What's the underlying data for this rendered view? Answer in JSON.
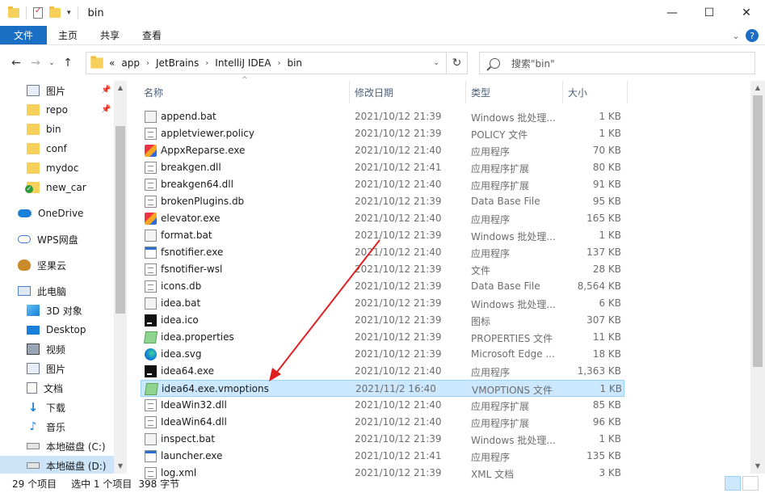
{
  "window": {
    "title": "bin",
    "min_glyph": "—",
    "max_glyph": "☐",
    "close_glyph": "✕"
  },
  "ribbon": {
    "tabs": [
      "文件",
      "主页",
      "共享",
      "查看"
    ],
    "help_glyph": "?"
  },
  "address": {
    "overflow": "«",
    "crumbs": [
      "app",
      "JetBrains",
      "IntelliJ IDEA",
      "bin"
    ],
    "search_placeholder": "搜索\"bin\""
  },
  "nav": {
    "quick_access": [
      {
        "label": "图片",
        "icon": "pictures-icon",
        "pinned": true
      },
      {
        "label": "repo",
        "icon": "folder-icon",
        "pinned": true
      },
      {
        "label": "bin",
        "icon": "folder-icon",
        "pinned": false
      },
      {
        "label": "conf",
        "icon": "folder-icon",
        "pinned": false
      },
      {
        "label": "mydoc",
        "icon": "folder-icon",
        "pinned": false
      },
      {
        "label": "new_car",
        "icon": "folder-check-icon",
        "pinned": false
      }
    ],
    "onedrive": "OneDrive",
    "wps": "WPS网盘",
    "jianguoyun": "坚果云",
    "this_pc": "此电脑",
    "pc_items": [
      {
        "label": "3D 对象",
        "icon": "3d-objects-icon"
      },
      {
        "label": "Desktop",
        "icon": "desktop-icon"
      },
      {
        "label": "视频",
        "icon": "videos-icon"
      },
      {
        "label": "图片",
        "icon": "pictures-icon"
      },
      {
        "label": "文档",
        "icon": "documents-icon"
      },
      {
        "label": "下载",
        "icon": "downloads-icon"
      },
      {
        "label": "音乐",
        "icon": "music-icon"
      },
      {
        "label": "本地磁盘 (C:)",
        "icon": "drive-c-icon"
      },
      {
        "label": "本地磁盘 (D:)",
        "icon": "drive-d-icon"
      }
    ]
  },
  "columns": {
    "name": "名称",
    "date": "修改日期",
    "type": "类型",
    "size": "大小"
  },
  "files": [
    {
      "name": "append.bat",
      "date": "2021/10/12 21:39",
      "type": "Windows 批处理...",
      "size": "1 KB",
      "icon": "batch-file-icon"
    },
    {
      "name": "appletviewer.policy",
      "date": "2021/10/12 21:39",
      "type": "POLICY 文件",
      "size": "1 KB",
      "icon": "document-icon"
    },
    {
      "name": "AppxReparse.exe",
      "date": "2021/10/12 21:40",
      "type": "应用程序",
      "size": "70 KB",
      "icon": "appx-icon"
    },
    {
      "name": "breakgen.dll",
      "date": "2021/10/12 21:41",
      "type": "应用程序扩展",
      "size": "80 KB",
      "icon": "dll-icon"
    },
    {
      "name": "breakgen64.dll",
      "date": "2021/10/12 21:40",
      "type": "应用程序扩展",
      "size": "91 KB",
      "icon": "dll-icon"
    },
    {
      "name": "brokenPlugins.db",
      "date": "2021/10/12 21:39",
      "type": "Data Base File",
      "size": "95 KB",
      "icon": "document-icon"
    },
    {
      "name": "elevator.exe",
      "date": "2021/10/12 21:40",
      "type": "应用程序",
      "size": "165 KB",
      "icon": "appx-icon"
    },
    {
      "name": "format.bat",
      "date": "2021/10/12 21:39",
      "type": "Windows 批处理...",
      "size": "1 KB",
      "icon": "batch-file-icon"
    },
    {
      "name": "fsnotifier.exe",
      "date": "2021/10/12 21:40",
      "type": "应用程序",
      "size": "137 KB",
      "icon": "exe-icon"
    },
    {
      "name": "fsnotifier-wsl",
      "date": "2021/10/12 21:39",
      "type": "文件",
      "size": "28 KB",
      "icon": "document-icon"
    },
    {
      "name": "icons.db",
      "date": "2021/10/12 21:39",
      "type": "Data Base File",
      "size": "8,564 KB",
      "icon": "document-icon"
    },
    {
      "name": "idea.bat",
      "date": "2021/10/12 21:39",
      "type": "Windows 批处理...",
      "size": "6 KB",
      "icon": "batch-file-icon"
    },
    {
      "name": "idea.ico",
      "date": "2021/10/12 21:39",
      "type": "图标",
      "size": "307 KB",
      "icon": "intellij-icon"
    },
    {
      "name": "idea.properties",
      "date": "2021/10/12 21:39",
      "type": "PROPERTIES 文件",
      "size": "11 KB",
      "icon": "properties-icon"
    },
    {
      "name": "idea.svg",
      "date": "2021/10/12 21:39",
      "type": "Microsoft Edge ...",
      "size": "18 KB",
      "icon": "edge-icon"
    },
    {
      "name": "idea64.exe",
      "date": "2021/10/12 21:40",
      "type": "应用程序",
      "size": "1,363 KB",
      "icon": "intellij-icon"
    },
    {
      "name": "idea64.exe.vmoptions",
      "date": "2021/11/2 16:40",
      "type": "VMOPTIONS 文件",
      "size": "1 KB",
      "icon": "properties-icon",
      "selected": true
    },
    {
      "name": "IdeaWin32.dll",
      "date": "2021/10/12 21:40",
      "type": "应用程序扩展",
      "size": "85 KB",
      "icon": "dll-icon"
    },
    {
      "name": "IdeaWin64.dll",
      "date": "2021/10/12 21:40",
      "type": "应用程序扩展",
      "size": "96 KB",
      "icon": "dll-icon"
    },
    {
      "name": "inspect.bat",
      "date": "2021/10/12 21:39",
      "type": "Windows 批处理...",
      "size": "1 KB",
      "icon": "batch-file-icon"
    },
    {
      "name": "launcher.exe",
      "date": "2021/10/12 21:41",
      "type": "应用程序",
      "size": "135 KB",
      "icon": "exe-icon"
    },
    {
      "name": "log.xml",
      "date": "2021/10/12 21:39",
      "type": "XML 文档",
      "size": "3 KB",
      "icon": "document-icon"
    }
  ],
  "status": {
    "count": "29 个项目",
    "selected": "选中 1 个项目",
    "size": "398 字节"
  },
  "colors": {
    "accent": "#1a6ec4",
    "selection": "#cce8ff",
    "annotation_arrow": "#e02020"
  }
}
